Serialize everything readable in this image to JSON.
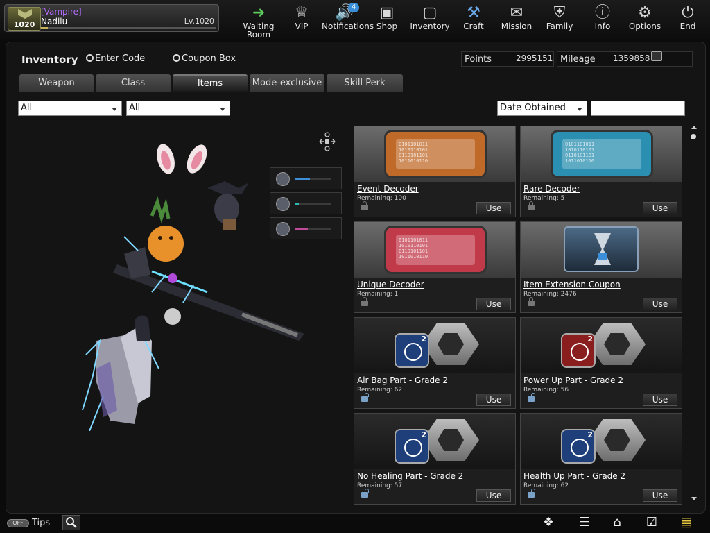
{
  "profile": {
    "tag": "[Vampire]",
    "name": "Nadilu",
    "level_text": "Lv.1020",
    "badge_level": "1020",
    "xp_fraction": 0.04
  },
  "nav": [
    {
      "label": "Waiting Room",
      "icon": "arrow-left-icon"
    },
    {
      "label": "VIP",
      "icon": "crown-icon"
    },
    {
      "label": "Notifications",
      "icon": "megaphone-icon",
      "badge": "4"
    },
    {
      "label": "Shop",
      "icon": "shop-icon"
    },
    {
      "label": "Inventory",
      "icon": "briefcase-icon"
    },
    {
      "label": "Craft",
      "icon": "craft-icon"
    },
    {
      "label": "Mission",
      "icon": "mission-icon"
    },
    {
      "label": "Family",
      "icon": "family-shield-icon"
    },
    {
      "label": "Info",
      "icon": "info-icon"
    },
    {
      "label": "Options",
      "icon": "gear-icon"
    },
    {
      "label": "End",
      "icon": "power-icon"
    }
  ],
  "header": {
    "title": "Inventory",
    "enter_code": "Enter Code",
    "coupon_box": "Coupon Box",
    "points_label": "Points",
    "points_value": "2995151",
    "mileage_label": "Mileage",
    "mileage_value": "1359858"
  },
  "tabs": [
    {
      "label": "Weapon",
      "active": false
    },
    {
      "label": "Class",
      "active": false
    },
    {
      "label": "Items",
      "active": true
    },
    {
      "label": "Mode-exclusive",
      "active": false
    },
    {
      "label": "Skill Perk",
      "active": false
    }
  ],
  "filters": {
    "filter1": "All",
    "filter2": "All",
    "sort": "Date Obtained",
    "search": ""
  },
  "preview_controls": [
    {
      "icon": "crosshair-icon",
      "fill": 0.4,
      "color": "#3f8fd8"
    },
    {
      "icon": "wrench-icon",
      "fill": 0.1,
      "color": "#2fb8b0"
    },
    {
      "icon": "notepad-icon",
      "fill": 0.35,
      "color": "#c04a9a"
    }
  ],
  "items": [
    {
      "name": "Event Decoder",
      "remaining": "Remaining: 100",
      "use": "Use",
      "kind": "ticket",
      "color": "#c06a2a",
      "locked": true
    },
    {
      "name": "Rare Decoder",
      "remaining": "Remaining: 5",
      "use": "Use",
      "kind": "ticket",
      "color": "#2a8fb0",
      "locked": true
    },
    {
      "name": "Unique Decoder",
      "remaining": "Remaining: 1",
      "use": "Use",
      "kind": "ticket",
      "color": "#c03a4a",
      "locked": true
    },
    {
      "name": "Item Extension Coupon",
      "remaining": "Remaining: 2476",
      "use": "Use",
      "kind": "hourglass",
      "color": "#4a6a8a",
      "locked": true
    },
    {
      "name": "Air Bag Part - Grade 2",
      "remaining": "Remaining: 62",
      "use": "Use",
      "kind": "part",
      "color": "#1e3f7a",
      "grade": "2",
      "locked": false
    },
    {
      "name": "Power Up Part - Grade 2",
      "remaining": "Remaining: 56",
      "use": "Use",
      "kind": "part",
      "color": "#8a1e1e",
      "grade": "2",
      "locked": false
    },
    {
      "name": "No Healing Part - Grade 2",
      "remaining": "Remaining: 57",
      "use": "Use",
      "kind": "part",
      "color": "#1e3f7a",
      "grade": "2",
      "locked": false
    },
    {
      "name": "Health Up Part - Grade 2",
      "remaining": "Remaining: 62",
      "use": "Use",
      "kind": "part",
      "color": "#1e3f7a",
      "grade": "2",
      "locked": false
    }
  ],
  "footer": {
    "tips_toggle": "OFF",
    "tips_label": "Tips"
  }
}
